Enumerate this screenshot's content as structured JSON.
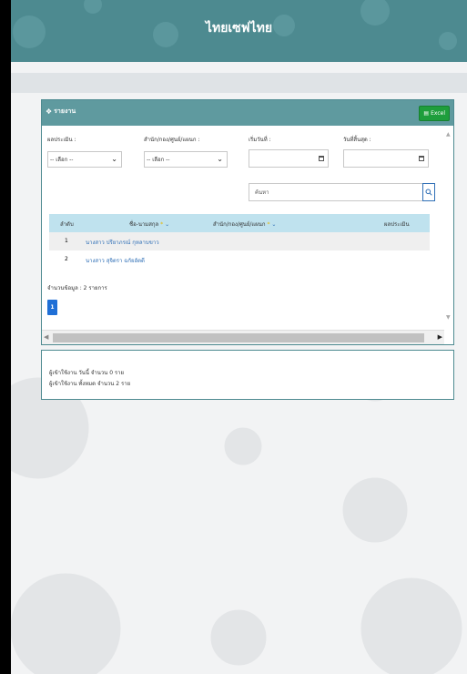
{
  "header": {
    "title": "ไทยเซฟไทย"
  },
  "panel": {
    "title": "รายงาน",
    "excel_label": "Excel",
    "filters": {
      "result_label": "ผลประเมิน :",
      "result_value": "-- เลือก --",
      "office_label": "สำนัก/กอง/ศูนย์/แผนก :",
      "office_value": "-- เลือก --",
      "start_label": "เริ่มวันที่ :",
      "end_label": "วันที่สิ้นสุด :"
    },
    "search": {
      "placeholder": "ค้นหา"
    },
    "table": {
      "columns": [
        "ลำดับ",
        "ชื่อ-นามสกุล",
        "สำนัก/กอง/ศูนย์/แผนก",
        "ผลประเมิน"
      ],
      "rows": [
        {
          "no": "1",
          "name": "นางสาว ปรียาภรณ์ กุหลาบขาว",
          "office": "",
          "result": ""
        },
        {
          "no": "2",
          "name": "นางสาว สุจิตรา ฉกัยอัตดี",
          "office": "",
          "result": ""
        }
      ]
    },
    "count_text": "จำนวนข้อมูล : 2 รายการ",
    "page": "1"
  },
  "stats": {
    "today": "ผู้เข้าใช้งาน วันนี้ จำนวน 0 ราย",
    "total": "ผู้เข้าใช้งาน ทั้งหมด จำนวน 2 ราย"
  },
  "colors": {
    "header": "#4d8a90",
    "excel": "#1e9e3c",
    "link": "#2f6fb6",
    "table_head": "#bfe2ee"
  }
}
